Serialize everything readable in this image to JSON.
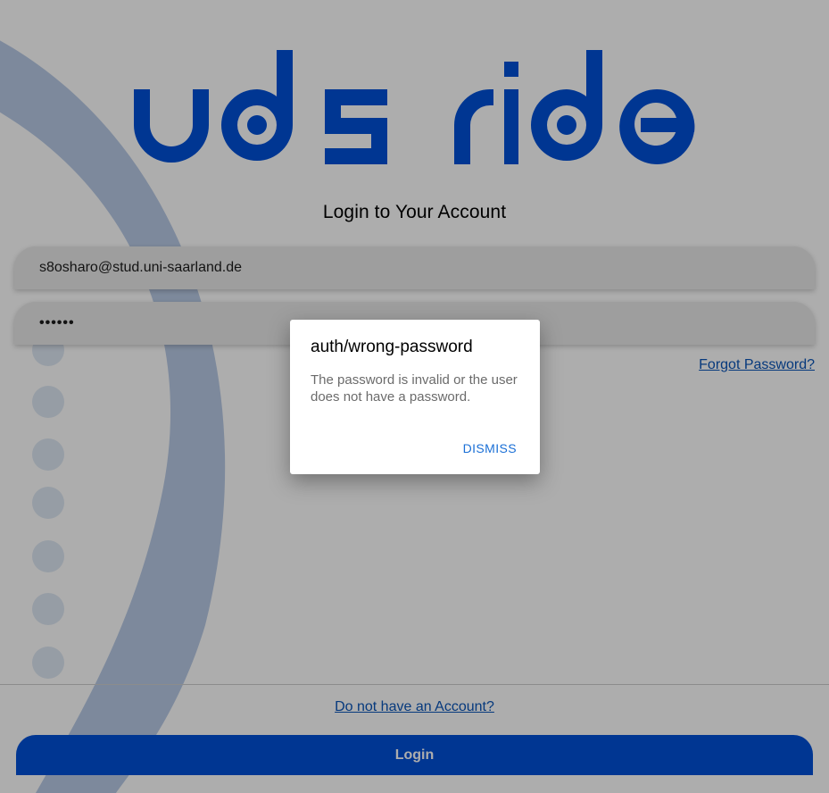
{
  "logo": {
    "text": "uds ride",
    "color": "#0050d8"
  },
  "page": {
    "title": "Login to Your Account"
  },
  "form": {
    "email_value": "s8osharo@stud.uni-saarland.de",
    "password_value": "••••••",
    "forgot_password_label": "Forgot Password?",
    "signup_link_label": "Do not have an Account?",
    "login_button_label": "Login"
  },
  "dialog": {
    "title": "auth/wrong-password",
    "message": "The password is invalid or the user does not have a password.",
    "dismiss_label": "DISMISS"
  },
  "colors": {
    "accent": "#0050d8",
    "link": "#0a55b8",
    "dialog_button": "#1a6fd6"
  }
}
